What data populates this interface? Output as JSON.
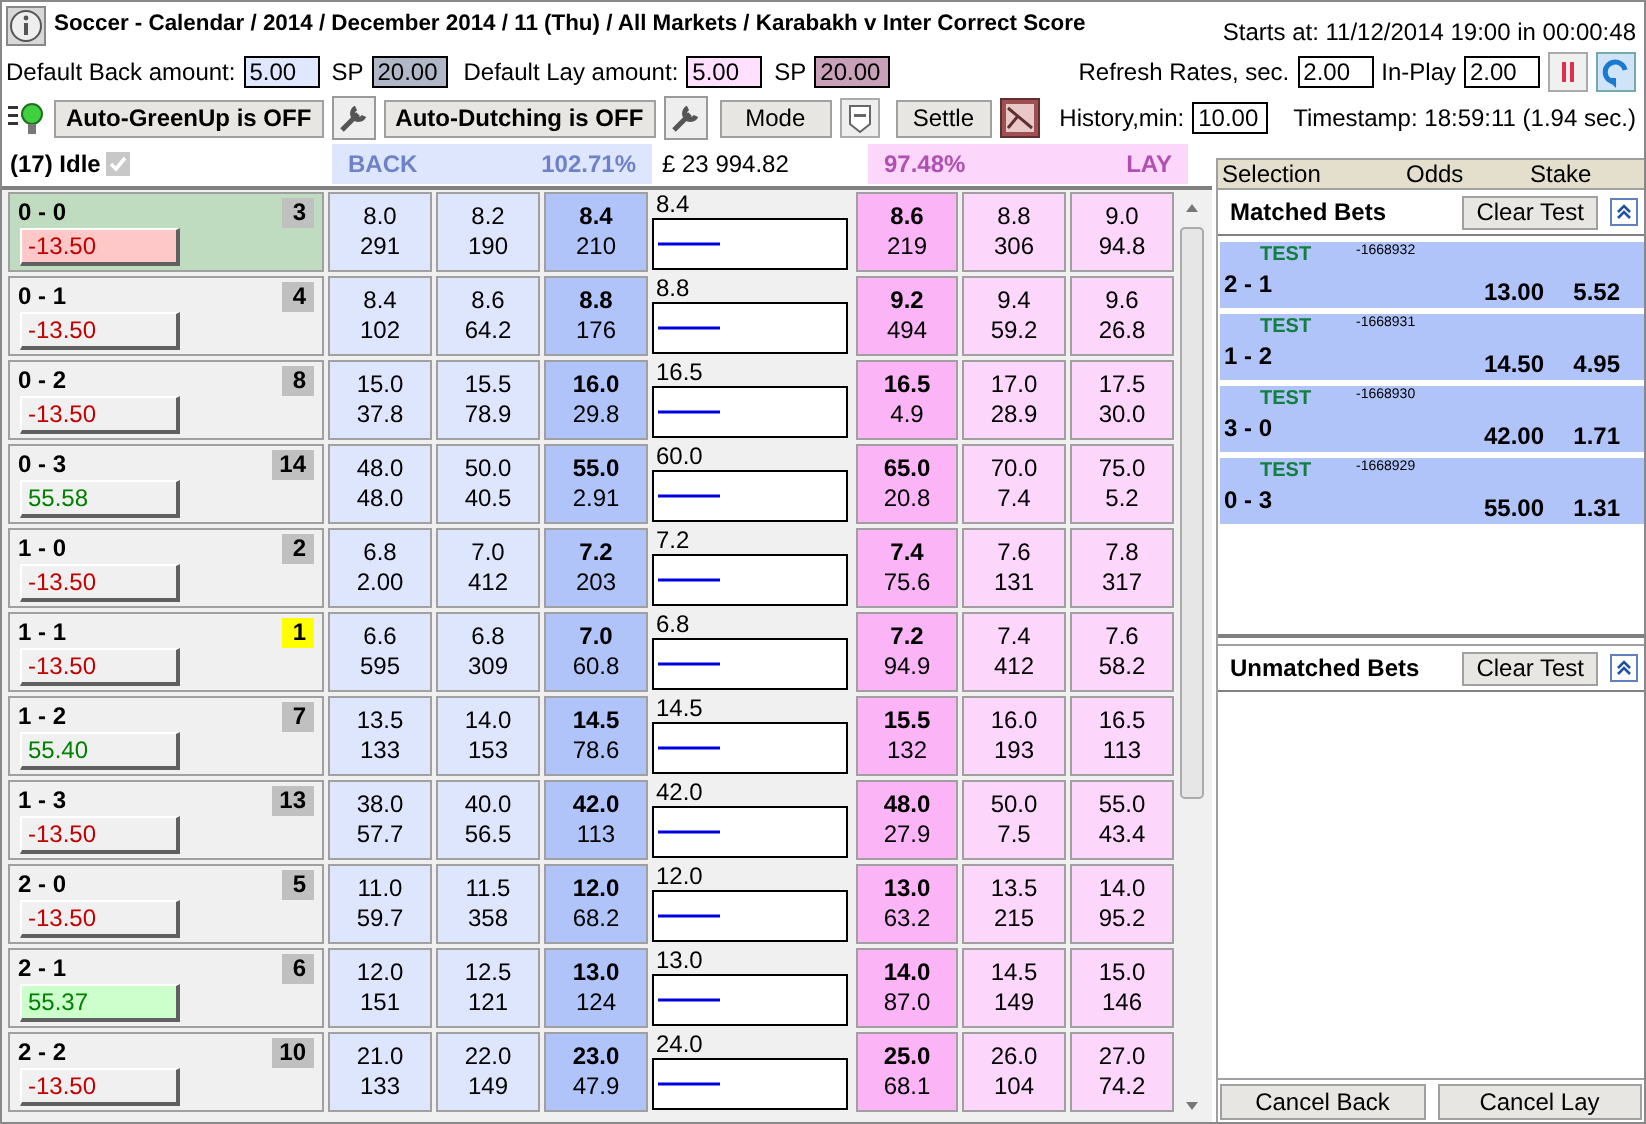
{
  "title": "Soccer - Calendar / 2014 / December 2014 / 11 (Thu) / All Markets / Karabakh v Inter Correct Score",
  "starts_at": "Starts at: 11/12/2014 19:00 in 00:00:48",
  "defaults": {
    "back_label": "Default Back amount:",
    "back_amount": "5.00",
    "back_sp_label": "SP",
    "back_sp": "20.00",
    "lay_label": "Default Lay amount:",
    "lay_amount": "5.00",
    "lay_sp_label": "SP",
    "lay_sp": "20.00"
  },
  "refresh": {
    "label": "Refresh Rates, sec.",
    "value": "2.00",
    "inplay_label": "In-Play",
    "inplay_value": "2.00"
  },
  "toolbar": {
    "auto_greenup": "Auto-GreenUp is OFF",
    "auto_dutching": "Auto-Dutching is OFF",
    "mode": "Mode",
    "settle": "Settle",
    "history_label": "History,min:",
    "history_value": "10.00",
    "timestamp": "Timestamp: 18:59:11 (1.94 sec.)"
  },
  "status": {
    "label": "(17) Idle",
    "checked": true
  },
  "back_header": {
    "label": "BACK",
    "percent": "102.71%"
  },
  "total_matched": "£ 23 994.82",
  "lay_header": {
    "percent": "97.48%",
    "label": "LAY"
  },
  "runners": [
    {
      "name": "0 - 0",
      "rank": "3",
      "color": "#c0c0c0",
      "selected": true,
      "pl": "-13.50",
      "profit": false,
      "highlight": true,
      "back": [
        [
          "8.0",
          "291"
        ],
        [
          "8.2",
          "190"
        ],
        [
          "8.4",
          "210"
        ]
      ],
      "last_traded": "8.4",
      "lay": [
        [
          "8.6",
          "219"
        ],
        [
          "8.8",
          "306"
        ],
        [
          "9.0",
          "94.8"
        ]
      ]
    },
    {
      "name": "0 - 1",
      "rank": "4",
      "color": "#c0c0c0",
      "selected": false,
      "pl": "-13.50",
      "profit": false,
      "highlight": false,
      "back": [
        [
          "8.4",
          "102"
        ],
        [
          "8.6",
          "64.2"
        ],
        [
          "8.8",
          "176"
        ]
      ],
      "last_traded": "8.8",
      "lay": [
        [
          "9.2",
          "494"
        ],
        [
          "9.4",
          "59.2"
        ],
        [
          "9.6",
          "26.8"
        ]
      ]
    },
    {
      "name": "0 - 2",
      "rank": "8",
      "color": "#c0c0c0",
      "selected": false,
      "pl": "-13.50",
      "profit": false,
      "highlight": false,
      "back": [
        [
          "15.0",
          "37.8"
        ],
        [
          "15.5",
          "78.9"
        ],
        [
          "16.0",
          "29.8"
        ]
      ],
      "last_traded": "16.5",
      "lay": [
        [
          "16.5",
          "4.9"
        ],
        [
          "17.0",
          "28.9"
        ],
        [
          "17.5",
          "30.0"
        ]
      ]
    },
    {
      "name": "0 - 3",
      "rank": "14",
      "color": "#c0c0c0",
      "selected": false,
      "pl": "55.58",
      "profit": true,
      "highlight": false,
      "back": [
        [
          "48.0",
          "48.0"
        ],
        [
          "50.0",
          "40.5"
        ],
        [
          "55.0",
          "2.91"
        ]
      ],
      "last_traded": "60.0",
      "lay": [
        [
          "65.0",
          "20.8"
        ],
        [
          "70.0",
          "7.4"
        ],
        [
          "75.0",
          "5.2"
        ]
      ]
    },
    {
      "name": "1 - 0",
      "rank": "2",
      "color": "#c0c0c0",
      "selected": false,
      "pl": "-13.50",
      "profit": false,
      "highlight": false,
      "back": [
        [
          "6.8",
          "2.00"
        ],
        [
          "7.0",
          "412"
        ],
        [
          "7.2",
          "203"
        ]
      ],
      "last_traded": "7.2",
      "lay": [
        [
          "7.4",
          "75.6"
        ],
        [
          "7.6",
          "131"
        ],
        [
          "7.8",
          "317"
        ]
      ]
    },
    {
      "name": "1 - 1",
      "rank": "1",
      "color": "#ffff00",
      "selected": false,
      "pl": "-13.50",
      "profit": false,
      "highlight": false,
      "back": [
        [
          "6.6",
          "595"
        ],
        [
          "6.8",
          "309"
        ],
        [
          "7.0",
          "60.8"
        ]
      ],
      "last_traded": "6.8",
      "lay": [
        [
          "7.2",
          "94.9"
        ],
        [
          "7.4",
          "412"
        ],
        [
          "7.6",
          "58.2"
        ]
      ]
    },
    {
      "name": "1 - 2",
      "rank": "7",
      "color": "#c0c0c0",
      "selected": false,
      "pl": "55.40",
      "profit": true,
      "highlight": false,
      "back": [
        [
          "13.5",
          "133"
        ],
        [
          "14.0",
          "153"
        ],
        [
          "14.5",
          "78.6"
        ]
      ],
      "last_traded": "14.5",
      "lay": [
        [
          "15.5",
          "132"
        ],
        [
          "16.0",
          "193"
        ],
        [
          "16.5",
          "113"
        ]
      ]
    },
    {
      "name": "1 - 3",
      "rank": "13",
      "color": "#c0c0c0",
      "selected": false,
      "pl": "-13.50",
      "profit": false,
      "highlight": false,
      "back": [
        [
          "38.0",
          "57.7"
        ],
        [
          "40.0",
          "56.5"
        ],
        [
          "42.0",
          "113"
        ]
      ],
      "last_traded": "42.0",
      "lay": [
        [
          "48.0",
          "27.9"
        ],
        [
          "50.0",
          "7.5"
        ],
        [
          "55.0",
          "43.4"
        ]
      ]
    },
    {
      "name": "2 - 0",
      "rank": "5",
      "color": "#c0c0c0",
      "selected": false,
      "pl": "-13.50",
      "profit": false,
      "highlight": false,
      "back": [
        [
          "11.0",
          "59.7"
        ],
        [
          "11.5",
          "358"
        ],
        [
          "12.0",
          "68.2"
        ]
      ],
      "last_traded": "12.0",
      "lay": [
        [
          "13.0",
          "63.2"
        ],
        [
          "13.5",
          "215"
        ],
        [
          "14.0",
          "95.2"
        ]
      ]
    },
    {
      "name": "2 - 1",
      "rank": "6",
      "color": "#c0c0c0",
      "selected": false,
      "pl": "55.37",
      "profit": true,
      "highlight": true,
      "back": [
        [
          "12.0",
          "151"
        ],
        [
          "12.5",
          "121"
        ],
        [
          "13.0",
          "124"
        ]
      ],
      "last_traded": "13.0",
      "lay": [
        [
          "14.0",
          "87.0"
        ],
        [
          "14.5",
          "149"
        ],
        [
          "15.0",
          "146"
        ]
      ]
    },
    {
      "name": "2 - 2",
      "rank": "10",
      "color": "#c0c0c0",
      "selected": false,
      "pl": "-13.50",
      "profit": false,
      "highlight": false,
      "back": [
        [
          "21.0",
          "133"
        ],
        [
          "22.0",
          "149"
        ],
        [
          "23.0",
          "47.9"
        ]
      ],
      "last_traded": "24.0",
      "lay": [
        [
          "25.0",
          "68.1"
        ],
        [
          "26.0",
          "104"
        ],
        [
          "27.0",
          "74.2"
        ]
      ]
    }
  ],
  "bets_panel": {
    "columns": [
      "Selection",
      "Odds",
      "Stake"
    ],
    "matched": {
      "title": "Matched Bets",
      "clear_button": "Clear Test",
      "bets": [
        {
          "tag": "TEST",
          "ref": "-1668932",
          "selection": "2 - 1",
          "odds": "13.00",
          "stake": "5.52"
        },
        {
          "tag": "TEST",
          "ref": "-1668931",
          "selection": "1 - 2",
          "odds": "14.50",
          "stake": "4.95"
        },
        {
          "tag": "TEST",
          "ref": "-1668930",
          "selection": "3 - 0",
          "odds": "42.00",
          "stake": "1.71"
        },
        {
          "tag": "TEST",
          "ref": "-1668929",
          "selection": "0 - 3",
          "odds": "55.00",
          "stake": "1.31"
        }
      ]
    },
    "unmatched": {
      "title": "Unmatched Bets",
      "clear_button": "Clear Test"
    },
    "buttons": [
      "Cancel Back",
      "Cancel Lay"
    ]
  }
}
